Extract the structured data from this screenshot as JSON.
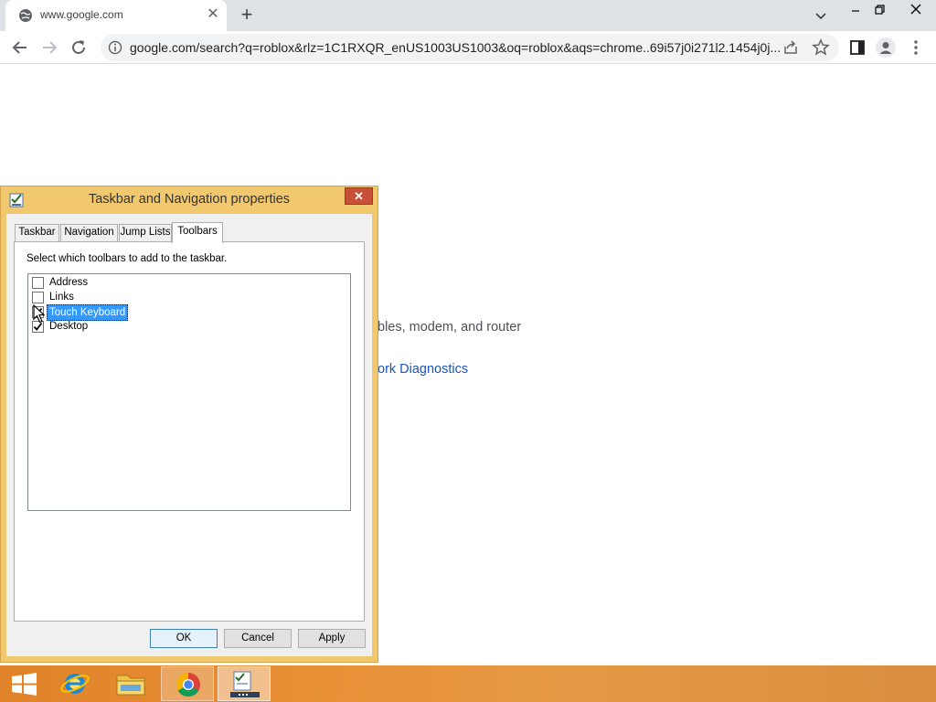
{
  "browser": {
    "tab_title": "www.google.com",
    "new_tab_glyph": "+",
    "close_glyph": "✕",
    "address_url": "google.com/search?q=roblox&rlz=1C1RXQR_enUS1003US1003&oq=roblox&aqs=chrome..69i57j0i271l2.1454j0j..."
  },
  "page": {
    "text_line": "bles, modem, and router",
    "link_text": "ork Diagnostics"
  },
  "dialog": {
    "title": "Taskbar and Navigation properties",
    "close_glyph": "✕",
    "tabs": [
      "Taskbar",
      "Navigation",
      "Jump Lists",
      "Toolbars"
    ],
    "active_tab": "Toolbars",
    "instruction": "Select which toolbars to add to the taskbar.",
    "toolbars": [
      {
        "label": "Address",
        "checked": false,
        "selected": false
      },
      {
        "label": "Links",
        "checked": false,
        "selected": false
      },
      {
        "label": "Touch Keyboard",
        "checked": true,
        "selected": true
      },
      {
        "label": "Desktop",
        "checked": true,
        "selected": false
      }
    ],
    "buttons": {
      "ok": "OK",
      "cancel": "Cancel",
      "apply": "Apply"
    }
  },
  "taskbar": {
    "items": [
      "start-icon",
      "internet-explorer-icon",
      "file-explorer-icon",
      "chrome-icon",
      "taskbar-properties-icon"
    ],
    "accent": "#e89036"
  },
  "colors": {
    "dialog_frame": "#f2c86e",
    "selection": "#3399ff",
    "link": "#1a55c0"
  }
}
